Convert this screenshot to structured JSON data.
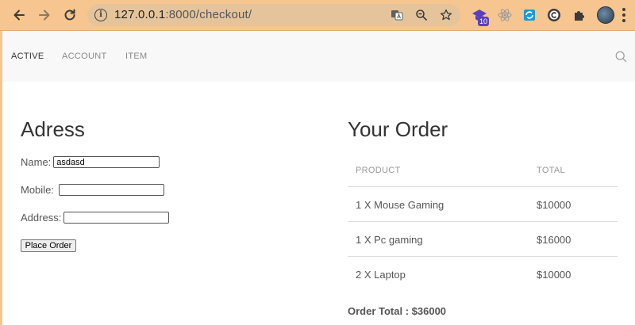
{
  "browser": {
    "url_host": "127.0.0.1",
    "url_rest": ":8000/checkout/",
    "extension_badge": "10"
  },
  "icons": {
    "back": "arrow-left-icon",
    "forward": "arrow-right-icon",
    "reload": "reload-icon",
    "site_info": "info-icon",
    "translate": "translate-icon",
    "zoom": "zoom-out-icon",
    "bookmark": "star-icon",
    "extensions": "puzzle-icon",
    "search": "search-icon"
  },
  "navbar": {
    "links": [
      "ACTIVE",
      "ACCOUNT",
      "ITEM"
    ]
  },
  "address": {
    "title": "Adress",
    "name_label": "Name:",
    "name_value": "asdasd",
    "mobile_label": "Mobile:",
    "mobile_value": "",
    "address_label": "Address:",
    "address_value": "",
    "submit_label": "Place Order"
  },
  "order": {
    "title": "Your Order",
    "columns": [
      "PRODUCT",
      "TOTAL"
    ],
    "rows": [
      {
        "product": "1 X Mouse Gaming",
        "total": "$10000"
      },
      {
        "product": "1 X Pc gaming",
        "total": "$16000"
      },
      {
        "product": "2 X Laptop",
        "total": "$10000"
      }
    ],
    "total_text": "Order Total : $36000"
  },
  "colors": {
    "browser_frame": "#f7c58f",
    "omnibox": "#e6c49b",
    "navbar_bg": "#f8f8f8"
  }
}
